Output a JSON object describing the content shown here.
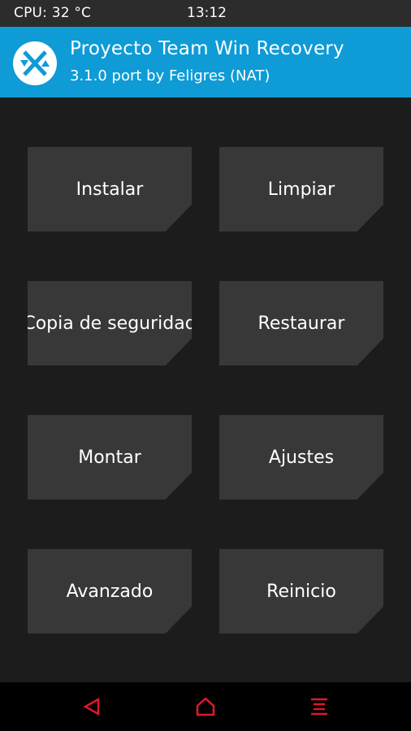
{
  "status": {
    "cpu": "CPU: 32 °C",
    "time": "13:12"
  },
  "header": {
    "title": "Proyecto Team Win Recovery",
    "subtitle": "3.1.0 port by Feligres (NAT)",
    "logo_icon": "twrp-logo-icon"
  },
  "menu": {
    "install": "Instalar",
    "wipe": "Limpiar",
    "backup": "Copia de seguridad",
    "restore": "Restaurar",
    "mount": "Montar",
    "settings": "Ajustes",
    "advanced": "Avanzado",
    "reboot": "Reinicio"
  },
  "navbar": {
    "back_icon": "back-triangle-icon",
    "home_icon": "home-icon",
    "menu_icon": "menu-lines-icon",
    "accent_color": "#e0172d"
  },
  "colors": {
    "header_bg": "#0e9bd6",
    "background": "#1c1c1c",
    "tile": "#383838"
  }
}
